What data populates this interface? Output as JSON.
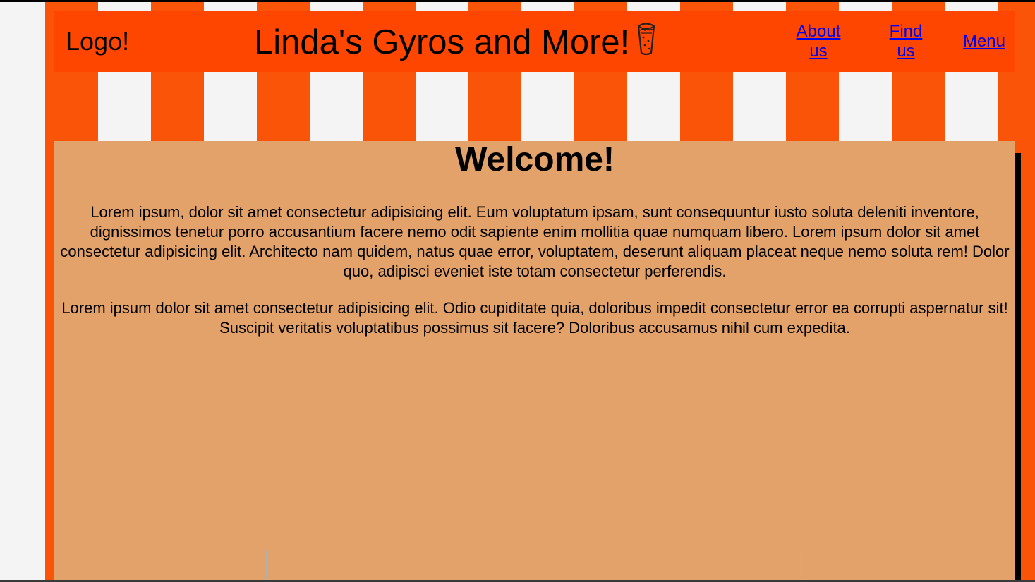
{
  "header": {
    "logo_text": "Logo!",
    "title": "Linda's Gyros and More!",
    "title_icon": "gyro-wrap-icon",
    "nav": {
      "about_label": "About us",
      "find_label": "Find us",
      "menu_label": "Menu"
    }
  },
  "main": {
    "heading": "Welcome!",
    "paragraphs": [
      "Lorem ipsum, dolor sit amet consectetur adipisicing elit. Eum voluptatum ipsam, sunt consequuntur iusto soluta deleniti inventore, dignissimos tenetur porro accusantium facere nemo odit sapiente enim mollitia quae numquam libero. Lorem ipsum dolor sit amet consectetur adipisicing elit. Architecto nam quidem, natus quae error, voluptatem, deserunt aliquam placeat neque nemo soluta rem! Dolor quo, adipisci eveniet iste totam consectetur perferendis.",
      "Lorem ipsum dolor sit amet consectetur adipisicing elit. Odio cupiditate quia, doloribus impedit consectetur error ea corrupti aspernatur sit! Suscipit veritatis voluptatibus possimus sit facere? Doloribus accusamus nihil cum expedita."
    ]
  },
  "colors": {
    "awning_orange": "#fa5408",
    "awning_white": "#f4f4f4",
    "header_bg": "#ff4600",
    "content_bg": "#e4a26b",
    "link": "#0000ee"
  }
}
